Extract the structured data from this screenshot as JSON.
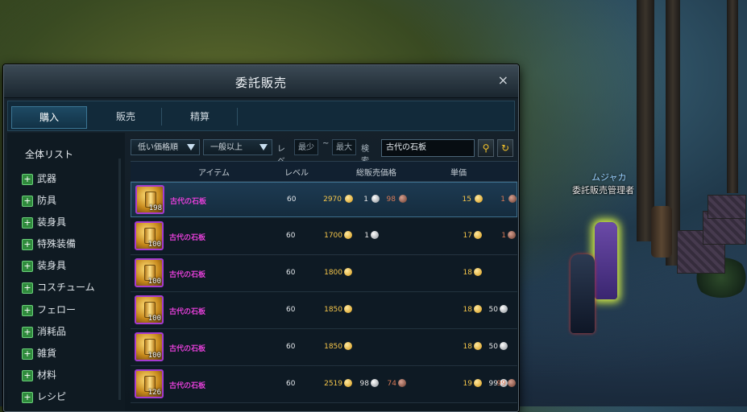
{
  "window": {
    "title": "委託販売",
    "close_glyph": "×"
  },
  "tabs": [
    {
      "label": "購入",
      "active": true
    },
    {
      "label": "販売",
      "active": false
    },
    {
      "label": "精算",
      "active": false
    }
  ],
  "sidebar": {
    "title": "全体リスト",
    "categories": [
      "武器",
      "防具",
      "装身具",
      "特殊装備",
      "装身具",
      "コスチューム",
      "フェロー",
      "消耗品",
      "雑貨",
      "材料",
      "レシピ"
    ]
  },
  "filters": {
    "sort": "低い価格順",
    "grade": "一般以上",
    "level_label": "レベ",
    "min_label": "最少",
    "range_sep": "~",
    "max_label": "最大",
    "search_label": "検索",
    "search_value": "古代の石板"
  },
  "table": {
    "headers": {
      "item": "アイテム",
      "level": "レベル",
      "total": "総販売価格",
      "unit": "単価"
    },
    "rows": [
      {
        "name": "古代の石板",
        "qty": "198",
        "level": "60",
        "total_gold": "2970",
        "total_silver": "1",
        "total_copper": "98",
        "unit_gold": "15",
        "unit_silver": "",
        "unit_copper": "1"
      },
      {
        "name": "古代の石板",
        "qty": "100",
        "level": "60",
        "total_gold": "1700",
        "total_silver": "1",
        "total_copper": "",
        "unit_gold": "17",
        "unit_silver": "",
        "unit_copper": "1"
      },
      {
        "name": "古代の石板",
        "qty": "100",
        "level": "60",
        "total_gold": "1800",
        "total_silver": "",
        "total_copper": "",
        "unit_gold": "18",
        "unit_silver": "",
        "unit_copper": ""
      },
      {
        "name": "古代の石板",
        "qty": "100",
        "level": "60",
        "total_gold": "1850",
        "total_silver": "",
        "total_copper": "",
        "unit_gold": "18",
        "unit_silver": "50",
        "unit_copper": ""
      },
      {
        "name": "古代の石板",
        "qty": "100",
        "level": "60",
        "total_gold": "1850",
        "total_silver": "",
        "total_copper": "",
        "unit_gold": "18",
        "unit_silver": "50",
        "unit_copper": ""
      },
      {
        "name": "古代の石板",
        "qty": "126",
        "level": "60",
        "total_gold": "2519",
        "total_silver": "98",
        "total_copper": "74",
        "unit_gold": "19",
        "unit_silver": "99",
        "unit_copper": "99"
      }
    ]
  },
  "npc": {
    "name": "ムジャカ",
    "title": "委託販売管理者"
  }
}
